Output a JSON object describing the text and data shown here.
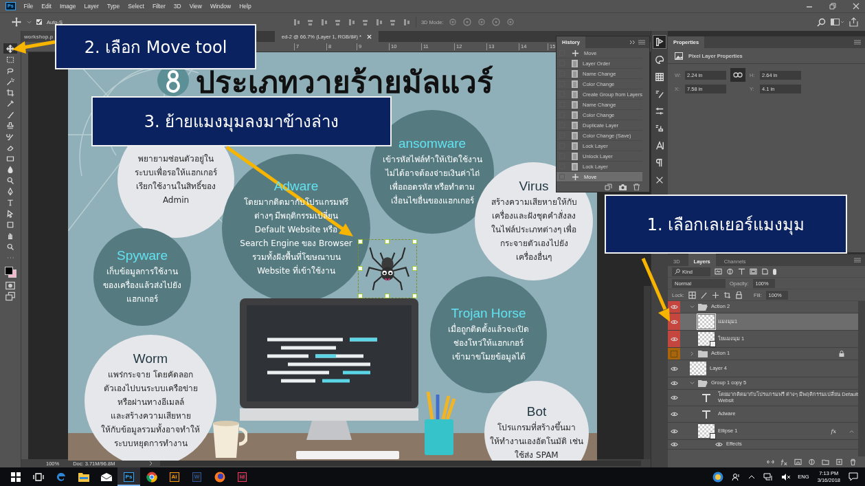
{
  "menu_bar": {
    "logo": "Ps",
    "items": [
      "File",
      "Edit",
      "Image",
      "Layer",
      "Type",
      "Select",
      "Filter",
      "3D",
      "View",
      "Window",
      "Help"
    ]
  },
  "options_bar": {
    "auto_select": {
      "label": "Auto-S",
      "checked": true
    },
    "mode_label": "3D Mode:"
  },
  "tools": [
    {
      "kind": "move",
      "selected": true
    },
    {
      "kind": "marquee",
      "selected": false
    },
    {
      "kind": "lasso",
      "selected": false
    },
    {
      "kind": "wand",
      "selected": false
    },
    {
      "kind": "crop",
      "selected": false
    },
    {
      "kind": "eyedropper",
      "selected": false
    },
    {
      "kind": "brush",
      "selected": false
    },
    {
      "kind": "stamp",
      "selected": false
    },
    {
      "kind": "history-brush",
      "selected": false
    },
    {
      "kind": "eraser",
      "selected": false
    },
    {
      "kind": "gradient",
      "selected": false
    },
    {
      "kind": "blur",
      "selected": false
    },
    {
      "kind": "dodge",
      "selected": false
    },
    {
      "kind": "pen",
      "selected": false
    },
    {
      "kind": "type",
      "selected": false
    },
    {
      "kind": "path",
      "selected": false
    },
    {
      "kind": "shape",
      "selected": false
    },
    {
      "kind": "hand",
      "selected": false
    },
    {
      "kind": "zoom",
      "selected": false
    },
    {
      "kind": "more",
      "selected": false
    }
  ],
  "document_tabs": [
    {
      "label": "workshop.p",
      "selected": false
    },
    {
      "label": "ed-2 @ 66.7% (Layer 1, RGB/8#) *",
      "selected": true
    }
  ],
  "ruler_ticks": [
    "7",
    "8",
    "9",
    "10",
    "11",
    "12",
    "13",
    "14",
    "15"
  ],
  "canvas": {
    "title": "ประเภทวายร้ายมัลแวร์",
    "circles": [
      {
        "kind": "light",
        "body": "พยายามซ่อนตัวอยู่ใน\nระบบเพื่อรอให้แฮกเกอร์\nเรียกใช้งานในสิทธิ์ของ\nAdmin"
      },
      {
        "kind": "dark",
        "heading": "ansomware",
        "body": "เข้ารหัสไฟล์ทำให้เปิดใช้งาน\nไม่ได้อาจต้องจ่ายเงินค่าไถ่\nเพื่อถอดรหัส หรือทำตาม\nเงื่อนไขอื่นของแฮกเกอร์"
      },
      {
        "kind": "dark",
        "heading": "Adware",
        "body": "โดยมากติดมากับโปรแกรมฟรี\nต่างๆ มีพฤติกรรมเปลี่ยน\nDefault Website หรือ\nSearch Engine ของ Browser\nรวมทั้งฝังพื้นที่โฆษณาบน\nWebsite ที่เข้าใช้งาน"
      },
      {
        "kind": "light",
        "heading": "Virus",
        "body": "สร้างความเสียหายให้กับ\nเครื่องและฝังชุดคำสั่งลง\nในไฟล์ประเภทต่างๆ เพื่อ\nกระจายตัวเองไปยัง\nเครื่องอื่นๆ"
      },
      {
        "kind": "dark",
        "heading": "Spyware",
        "body": "เก็บข้อมูลการใช้งาน\nของเครื่องแล้วส่งไปยัง\nแฮกเกอร์"
      },
      {
        "kind": "dark",
        "heading": "Trojan Horse",
        "body": "เมื่อถูกติดตั้งแล้วจะเปิด\nช่องโหว่ให้แฮกเกอร์\nเข้ามาขโมยข้อมูลได้"
      },
      {
        "kind": "light",
        "heading": "Worm",
        "body": "แพร่กระจาย โดยคัดลอก\nตัวเองไปบนระบบเครือข่าย\nหรือผ่านทางอีเมลล์\nและสร้างความเสียหาย\nให้กับข้อมูลรวมทั้งอาจทำให้\nระบบหยุดการทำงาน"
      },
      {
        "kind": "light",
        "heading": "Bot",
        "body": "โปรแกรมที่สร้างขึ้นมา\nให้ทำงานเองอัตโนมัติ เช่น\nใช้ส่ง SPAM"
      }
    ]
  },
  "status_bar": {
    "zoom": "100%",
    "doc_size": "Doc: 3.71M/96.8M"
  },
  "history": {
    "title": "History",
    "items": [
      {
        "kind": "move",
        "label": "Move",
        "selected": false
      },
      {
        "kind": "step",
        "label": "Layer Order",
        "selected": false
      },
      {
        "kind": "step",
        "label": "Name Change",
        "selected": false
      },
      {
        "kind": "step",
        "label": "Color Change",
        "selected": false
      },
      {
        "kind": "step",
        "label": "Create Group from Layers",
        "selected": false
      },
      {
        "kind": "step",
        "label": "Name Change",
        "selected": false
      },
      {
        "kind": "step",
        "label": "Color Change",
        "selected": false
      },
      {
        "kind": "step",
        "label": "Duplicate Layer",
        "selected": false
      },
      {
        "kind": "step",
        "label": "Color Change (Save)",
        "selected": false
      },
      {
        "kind": "step",
        "label": "Lock Layer",
        "selected": false
      },
      {
        "kind": "step",
        "label": "Unlock Layer",
        "selected": false
      },
      {
        "kind": "step",
        "label": "Lock Layer",
        "selected": false
      },
      {
        "kind": "move",
        "label": "Move",
        "selected": true
      }
    ]
  },
  "properties": {
    "title": "Properties",
    "subtitle": "Pixel Layer Properties",
    "fields": [
      {
        "label": "W:",
        "value": "2.24 in"
      },
      {
        "label": "H:",
        "value": "2.64 in"
      },
      {
        "label": "X:",
        "value": "7.58 in"
      },
      {
        "label": "Y:",
        "value": "4.1 in"
      }
    ]
  },
  "layers": {
    "tabs": [
      {
        "label": "3D",
        "selected": false
      },
      {
        "label": "Layers",
        "selected": true
      },
      {
        "label": "Channels",
        "selected": false
      }
    ],
    "filter": "Kind",
    "blend_mode": "Normal",
    "opacity_label": "Opacity:",
    "opacity": "100%",
    "lock_label": "Lock:",
    "fill_label": "Fill:",
    "fill": "100%",
    "rows": [
      {
        "kind": "group",
        "name": "Action 2",
        "visible": true,
        "selected": false,
        "color": "#c4463f",
        "expanded": true,
        "children": [
          {
            "kind": "pixel",
            "name": "แมงมุม1",
            "visible": true,
            "selected": true,
            "color": "#c4463f"
          },
          {
            "kind": "smart",
            "name": "ใยแมงมุม 1",
            "visible": true,
            "selected": false,
            "color": "#c4463f"
          }
        ]
      },
      {
        "kind": "group",
        "name": "Action 1",
        "visible": false,
        "selected": false,
        "color": "#a8650c",
        "expanded": false,
        "locked": true
      },
      {
        "kind": "pixel",
        "name": "Layer 4",
        "visible": true,
        "selected": false
      },
      {
        "kind": "group",
        "name": "Group 1 copy 5",
        "visible": true,
        "selected": false,
        "expanded": true,
        "children": [
          {
            "kind": "text",
            "name": "โดยมากติดมากับโปรแกรมฟรี ต่างๆ มีพฤติกรรมเปลี่ยน Default Websit",
            "visible": true,
            "selected": false
          },
          {
            "kind": "text",
            "name": "Adware",
            "visible": true,
            "selected": false
          },
          {
            "kind": "smart",
            "name": "Ellipse 1",
            "visible": true,
            "selected": false,
            "fx": "fx",
            "expanded": true,
            "children": [
              {
                "kind": "effects",
                "name": "Effects",
                "visible": true,
                "selected": false
              }
            ]
          }
        ]
      }
    ]
  },
  "taskbar": {
    "apps": [
      {
        "kind": "start",
        "active": false
      },
      {
        "kind": "task-view",
        "active": false
      },
      {
        "kind": "edge",
        "active": false
      },
      {
        "kind": "explorer",
        "active": false
      },
      {
        "kind": "mail",
        "active": false
      },
      {
        "kind": "letter",
        "label": "Ps",
        "color": "#31a8ff",
        "active": true
      },
      {
        "kind": "chrome",
        "active": false
      },
      {
        "kind": "letter",
        "label": "Ai",
        "color": "#ff9a00",
        "active": false
      },
      {
        "kind": "letter",
        "label": "W",
        "color": "#2b579a",
        "active": false
      },
      {
        "kind": "firefox",
        "active": false
      },
      {
        "kind": "letter",
        "label": "Id",
        "color": "#ff3366",
        "active": false
      }
    ],
    "language": "ENG",
    "time": "7:13 PM",
    "date": "3/16/2018"
  },
  "callouts": [
    {
      "text": "2. เลือก Move tool"
    },
    {
      "text": "3. ย้ายแมงมุมลงมาข้างล่าง"
    },
    {
      "text": "1.  เลือกเลเยอร์แมงมุม"
    }
  ]
}
